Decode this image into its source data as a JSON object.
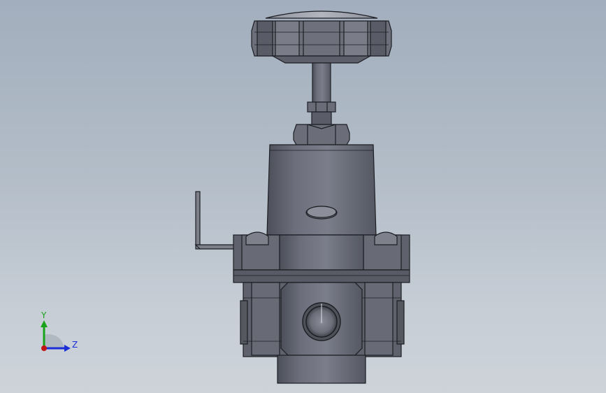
{
  "viewport": {
    "background_top": "#a2aebd",
    "background_bottom": "#cdd3d9"
  },
  "model": {
    "part_color": "#6b6e7a",
    "part_highlight": "#8e919d",
    "part_shadow": "#4b4e58",
    "edge_color": "#1d1e24"
  },
  "triad": {
    "y_label": "Y",
    "z_label": "Z",
    "y_color": "#1aa31a",
    "z_color": "#1c2fd6",
    "x_color": "#c01515"
  }
}
